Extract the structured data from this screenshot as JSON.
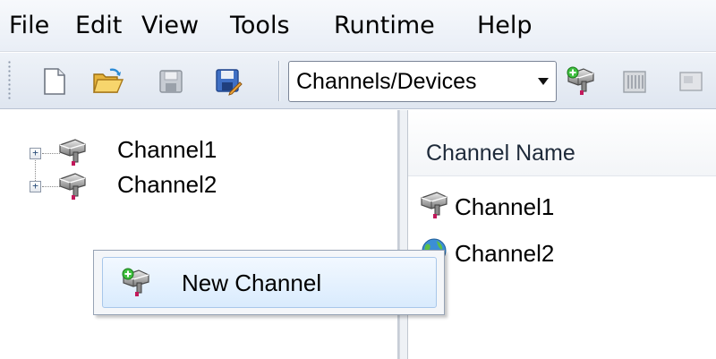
{
  "menubar": {
    "items": [
      {
        "label": "File"
      },
      {
        "label": "Edit"
      },
      {
        "label": "View"
      },
      {
        "label": "Tools"
      },
      {
        "label": "Runtime"
      },
      {
        "label": "Help"
      }
    ]
  },
  "toolbar": {
    "buttons": [
      "new-file-icon",
      "open-folder-icon",
      "save-icon",
      "save-as-icon"
    ],
    "view_select": {
      "value": "Channels/Devices"
    },
    "trailing_buttons": [
      "new-channel-icon",
      "new-device-icon",
      "device-properties-icon"
    ]
  },
  "tree": {
    "items": [
      {
        "label": "Channel1",
        "icon": "channel-icon",
        "expander": "+"
      },
      {
        "label": "Channel2",
        "icon": "channel-icon",
        "expander": "+"
      }
    ]
  },
  "detail": {
    "column_header": "Channel Name",
    "rows": [
      {
        "label": "Channel1",
        "icon": "channel-icon"
      },
      {
        "label": "Channel2",
        "icon": "globe-channel-icon"
      }
    ]
  },
  "context_menu": {
    "items": [
      {
        "label": "New Channel",
        "icon": "new-channel-icon"
      }
    ]
  },
  "colors": {
    "menubar_bg": "#eef2f8",
    "hover_item_border": "#a8c7ea",
    "hover_item_bg": "#d9ebfd"
  }
}
